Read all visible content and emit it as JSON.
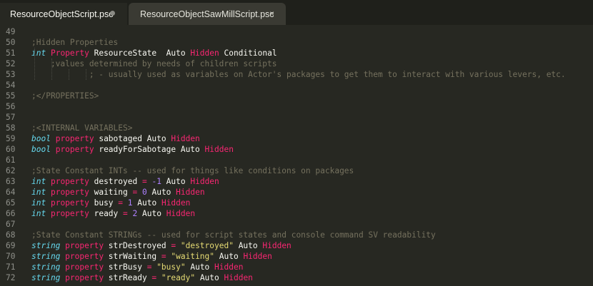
{
  "tabs": [
    {
      "label": "ResourceObjectScript.psc",
      "state": "active",
      "modified_icon": "unsaved-dot-icon"
    },
    {
      "label": "ResourceObjectSawMillScript.psc",
      "state": "inactive",
      "close_glyph": "×"
    }
  ],
  "colors": {
    "background": "#272822",
    "comment": "#75715e",
    "type": "#66d9ef",
    "keyword": "#f92672",
    "number": "#ae81ff",
    "string": "#e6db74",
    "text": "#f8f8f2"
  },
  "lines": [
    {
      "n": "49",
      "tokens": []
    },
    {
      "n": "50",
      "tokens": [
        {
          "c": "c",
          "v": ";Hidden Properties"
        }
      ]
    },
    {
      "n": "51",
      "tokens": [
        {
          "c": "k",
          "v": "int"
        },
        {
          "c": "t",
          "v": " "
        },
        {
          "c": "p",
          "v": "Property"
        },
        {
          "c": "t",
          "v": " ResourceState  Auto "
        },
        {
          "c": "p",
          "v": "Hidden"
        },
        {
          "c": "t",
          "v": " Conditional"
        }
      ]
    },
    {
      "n": "52",
      "tokens": [
        {
          "c": "c",
          "v": "    ;values determined by needs of children scripts"
        }
      ]
    },
    {
      "n": "53",
      "tokens": [
        {
          "c": "c",
          "v": "            ; - usually used as variables on Actor's packages to get them to interact with various levers, etc."
        }
      ]
    },
    {
      "n": "54",
      "tokens": []
    },
    {
      "n": "55",
      "tokens": [
        {
          "c": "c",
          "v": ";</PROPERTIES>"
        }
      ]
    },
    {
      "n": "56",
      "tokens": []
    },
    {
      "n": "57",
      "tokens": []
    },
    {
      "n": "58",
      "tokens": [
        {
          "c": "c",
          "v": ";<INTERNAL VARIABLES>"
        }
      ]
    },
    {
      "n": "59",
      "tokens": [
        {
          "c": "k",
          "v": "bool"
        },
        {
          "c": "t",
          "v": " "
        },
        {
          "c": "p",
          "v": "property"
        },
        {
          "c": "t",
          "v": " sabotaged Auto "
        },
        {
          "c": "p",
          "v": "Hidden"
        }
      ]
    },
    {
      "n": "60",
      "tokens": [
        {
          "c": "k",
          "v": "bool"
        },
        {
          "c": "t",
          "v": " "
        },
        {
          "c": "p",
          "v": "property"
        },
        {
          "c": "t",
          "v": " readyForSabotage Auto "
        },
        {
          "c": "p",
          "v": "Hidden"
        }
      ]
    },
    {
      "n": "61",
      "tokens": []
    },
    {
      "n": "62",
      "tokens": [
        {
          "c": "c",
          "v": ";State Constant INTs -- used for things like conditions on packages"
        }
      ]
    },
    {
      "n": "63",
      "tokens": [
        {
          "c": "k",
          "v": "int"
        },
        {
          "c": "t",
          "v": " "
        },
        {
          "c": "p",
          "v": "property"
        },
        {
          "c": "t",
          "v": " destroyed "
        },
        {
          "c": "p",
          "v": "="
        },
        {
          "c": "t",
          "v": " "
        },
        {
          "c": "n",
          "v": "-1"
        },
        {
          "c": "t",
          "v": " Auto "
        },
        {
          "c": "p",
          "v": "Hidden"
        }
      ]
    },
    {
      "n": "64",
      "tokens": [
        {
          "c": "k",
          "v": "int"
        },
        {
          "c": "t",
          "v": " "
        },
        {
          "c": "p",
          "v": "property"
        },
        {
          "c": "t",
          "v": " waiting "
        },
        {
          "c": "p",
          "v": "="
        },
        {
          "c": "t",
          "v": " "
        },
        {
          "c": "n",
          "v": "0"
        },
        {
          "c": "t",
          "v": " Auto "
        },
        {
          "c": "p",
          "v": "Hidden"
        }
      ]
    },
    {
      "n": "65",
      "tokens": [
        {
          "c": "k",
          "v": "int"
        },
        {
          "c": "t",
          "v": " "
        },
        {
          "c": "p",
          "v": "property"
        },
        {
          "c": "t",
          "v": " busy "
        },
        {
          "c": "p",
          "v": "="
        },
        {
          "c": "t",
          "v": " "
        },
        {
          "c": "n",
          "v": "1"
        },
        {
          "c": "t",
          "v": " Auto "
        },
        {
          "c": "p",
          "v": "Hidden"
        }
      ]
    },
    {
      "n": "66",
      "tokens": [
        {
          "c": "k",
          "v": "int"
        },
        {
          "c": "t",
          "v": " "
        },
        {
          "c": "p",
          "v": "property"
        },
        {
          "c": "t",
          "v": " ready "
        },
        {
          "c": "p",
          "v": "="
        },
        {
          "c": "t",
          "v": " "
        },
        {
          "c": "n",
          "v": "2"
        },
        {
          "c": "t",
          "v": " Auto "
        },
        {
          "c": "p",
          "v": "Hidden"
        }
      ]
    },
    {
      "n": "67",
      "tokens": []
    },
    {
      "n": "68",
      "tokens": [
        {
          "c": "c",
          "v": ";State Constant STRINGs -- used for script states and console command SV readability"
        }
      ]
    },
    {
      "n": "69",
      "tokens": [
        {
          "c": "k",
          "v": "string"
        },
        {
          "c": "t",
          "v": " "
        },
        {
          "c": "p",
          "v": "property"
        },
        {
          "c": "t",
          "v": " strDestroyed "
        },
        {
          "c": "p",
          "v": "="
        },
        {
          "c": "t",
          "v": " "
        },
        {
          "c": "s",
          "v": "\"destroyed\""
        },
        {
          "c": "t",
          "v": " Auto "
        },
        {
          "c": "p",
          "v": "Hidden"
        }
      ]
    },
    {
      "n": "70",
      "tokens": [
        {
          "c": "k",
          "v": "string"
        },
        {
          "c": "t",
          "v": " "
        },
        {
          "c": "p",
          "v": "property"
        },
        {
          "c": "t",
          "v": " strWaiting "
        },
        {
          "c": "p",
          "v": "="
        },
        {
          "c": "t",
          "v": " "
        },
        {
          "c": "s",
          "v": "\"waiting\""
        },
        {
          "c": "t",
          "v": " Auto "
        },
        {
          "c": "p",
          "v": "Hidden"
        }
      ]
    },
    {
      "n": "71",
      "tokens": [
        {
          "c": "k",
          "v": "string"
        },
        {
          "c": "t",
          "v": " "
        },
        {
          "c": "p",
          "v": "property"
        },
        {
          "c": "t",
          "v": " strBusy "
        },
        {
          "c": "p",
          "v": "="
        },
        {
          "c": "t",
          "v": " "
        },
        {
          "c": "s",
          "v": "\"busy\""
        },
        {
          "c": "t",
          "v": " Auto "
        },
        {
          "c": "p",
          "v": "Hidden"
        }
      ]
    },
    {
      "n": "72",
      "tokens": [
        {
          "c": "k",
          "v": "string"
        },
        {
          "c": "t",
          "v": " "
        },
        {
          "c": "p",
          "v": "property"
        },
        {
          "c": "t",
          "v": " strReady "
        },
        {
          "c": "p",
          "v": "="
        },
        {
          "c": "t",
          "v": " "
        },
        {
          "c": "s",
          "v": "\"ready\""
        },
        {
          "c": "t",
          "v": " Auto "
        },
        {
          "c": "p",
          "v": "Hidden"
        }
      ]
    }
  ]
}
